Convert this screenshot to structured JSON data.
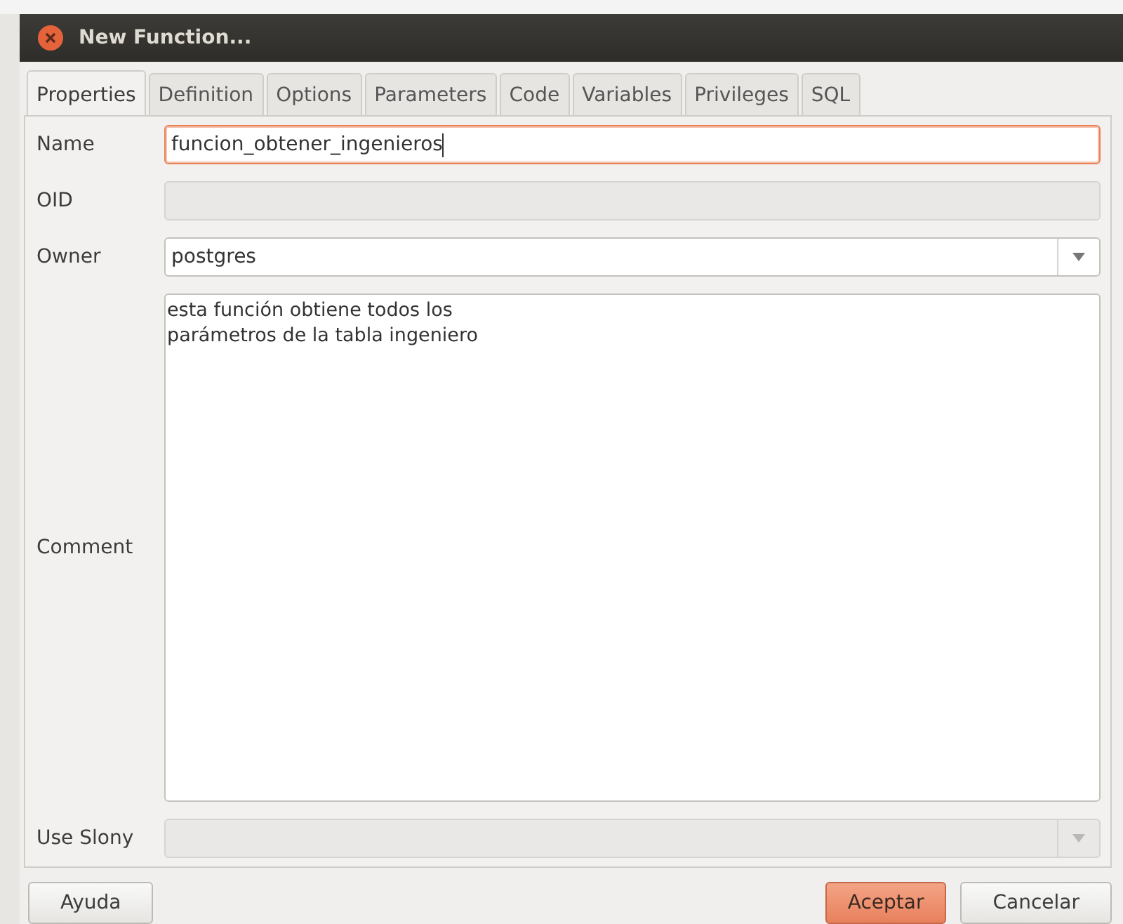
{
  "window": {
    "title": "New Function..."
  },
  "tabs": [
    {
      "label": "Properties",
      "selected": true
    },
    {
      "label": "Definition",
      "selected": false
    },
    {
      "label": "Options",
      "selected": false
    },
    {
      "label": "Parameters",
      "selected": false
    },
    {
      "label": "Code",
      "selected": false
    },
    {
      "label": "Variables",
      "selected": false
    },
    {
      "label": "Privileges",
      "selected": false
    },
    {
      "label": "SQL",
      "selected": false
    }
  ],
  "fields": [
    {
      "label": "Name",
      "kind": "text",
      "value": "funcion_obtener_ingenieros",
      "focused": true,
      "disabled": false
    },
    {
      "label": "OID",
      "kind": "text",
      "disabled": true,
      "focused": false
    },
    {
      "label": "Owner",
      "kind": "combo",
      "value": "postgres",
      "disabled": false,
      "focused": false
    },
    {
      "label": "Comment",
      "kind": "textarea",
      "value": "esta función obtiene todos los\nparámetros de la tabla ingeniero",
      "disabled": false,
      "focused": false
    },
    {
      "label": "Use Slony",
      "kind": "combo",
      "disabled": true,
      "focused": false
    }
  ],
  "left_buttons": [
    {
      "label": "Ayuda",
      "default": false
    }
  ],
  "right_buttons": [
    {
      "label": "Aceptar",
      "default": true
    },
    {
      "label": "Cancelar",
      "default": false
    }
  ]
}
